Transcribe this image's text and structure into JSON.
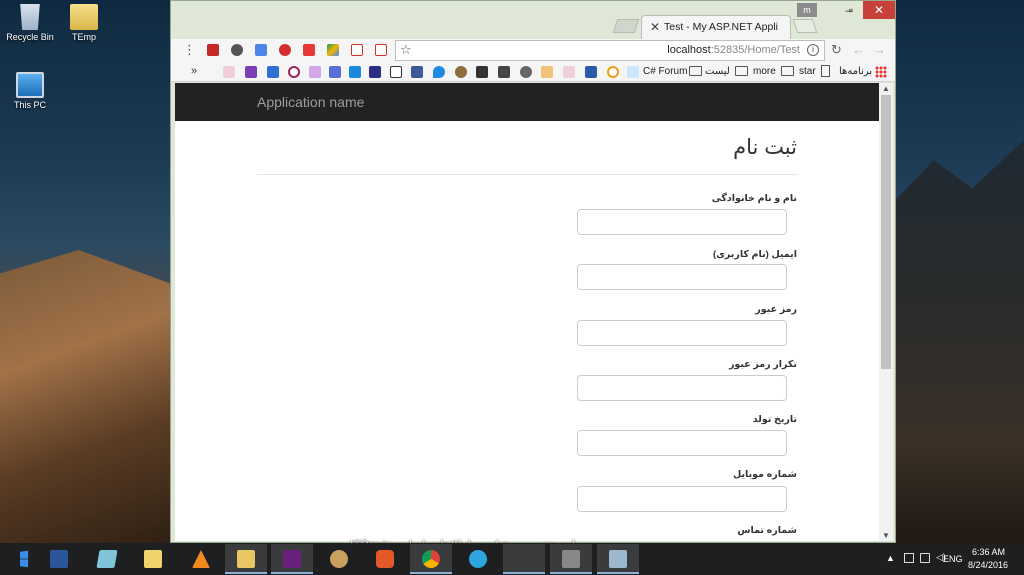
{
  "desktop": {
    "icons": [
      {
        "label": "Recycle Bin"
      },
      {
        "label": "TEmp"
      },
      {
        "label": "This PC"
      }
    ]
  },
  "browser": {
    "user_badge": "m",
    "tab_title": "Test - My ASP.NET Appli",
    "url_host": "localhost",
    "url_rest": ":52835/Home/Test",
    "bookmarks": {
      "apps": "برنامه‌ها",
      "star": "star",
      "more": "more",
      "list": "لیست",
      "csharp": "C# Forum"
    }
  },
  "page": {
    "brand": "Application name",
    "title": "ثبت نام",
    "fields": [
      {
        "label": "نام و نام خانوادگی"
      },
      {
        "label": "ایمیل (نام کاربری)"
      },
      {
        "label": "رمز عبور"
      },
      {
        "label": "تکرار رمز عبور"
      },
      {
        "label": "تاریخ تولد"
      },
      {
        "label": "شماره موبایل"
      },
      {
        "label": "شماره تماس"
      }
    ]
  },
  "watermark": "وب سایت تخصصی فناوری اطلاعات ایران - ITPro.ir",
  "taskbar": {
    "language": "ENG",
    "time": "6:36 AM",
    "date": "8/24/2016"
  }
}
